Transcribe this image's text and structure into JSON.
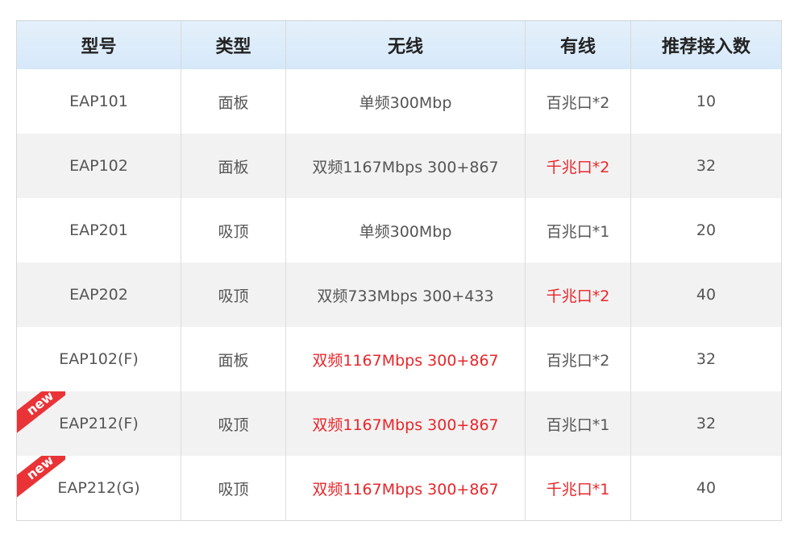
{
  "table": {
    "headers": [
      "型号",
      "类型",
      "无线",
      "有线",
      "推荐接入数"
    ],
    "rows": [
      {
        "model": "EAP101",
        "type": "面板",
        "wireless": "单频300Mbp",
        "wired": "百兆口*2",
        "recommended": "10",
        "wireless_highlight": false,
        "wired_highlight": false,
        "new_badge": ""
      },
      {
        "model": "EAP102",
        "type": "面板",
        "wireless": "双频1167Mbps 300+867",
        "wired": "千兆口*2",
        "recommended": "32",
        "wireless_highlight": false,
        "wired_highlight": true,
        "new_badge": ""
      },
      {
        "model": "EAP201",
        "type": "吸顶",
        "wireless": "单频300Mbp",
        "wired": "百兆口*1",
        "recommended": "20",
        "wireless_highlight": false,
        "wired_highlight": false,
        "new_badge": ""
      },
      {
        "model": "EAP202",
        "type": "吸顶",
        "wireless": "双频733Mbps 300+433",
        "wired": "千兆口*2",
        "recommended": "40",
        "wireless_highlight": false,
        "wired_highlight": true,
        "new_badge": ""
      },
      {
        "model": "EAP102(F)",
        "type": "面板",
        "wireless": "双频1167Mbps 300+867",
        "wired": "百兆口*2",
        "recommended": "32",
        "wireless_highlight": true,
        "wired_highlight": false,
        "new_badge": ""
      },
      {
        "model": "EAP212(F)",
        "type": "吸顶",
        "wireless": "双频1167Mbps 300+867",
        "wired": "百兆口*1",
        "recommended": "32",
        "wireless_highlight": true,
        "wired_highlight": false,
        "new_badge": "new"
      },
      {
        "model": "EAP212(G)",
        "type": "吸顶",
        "wireless": "双频1167Mbps 300+867",
        "wired": "千兆口*1",
        "recommended": "40",
        "wireless_highlight": true,
        "wired_highlight": true,
        "new_badge": "new"
      }
    ]
  },
  "colors": {
    "highlight": "#e8262a",
    "header_bg": "#d6e8f9",
    "stripe_bg": "#f3f2f2",
    "badge_bg": "#ea3337"
  }
}
